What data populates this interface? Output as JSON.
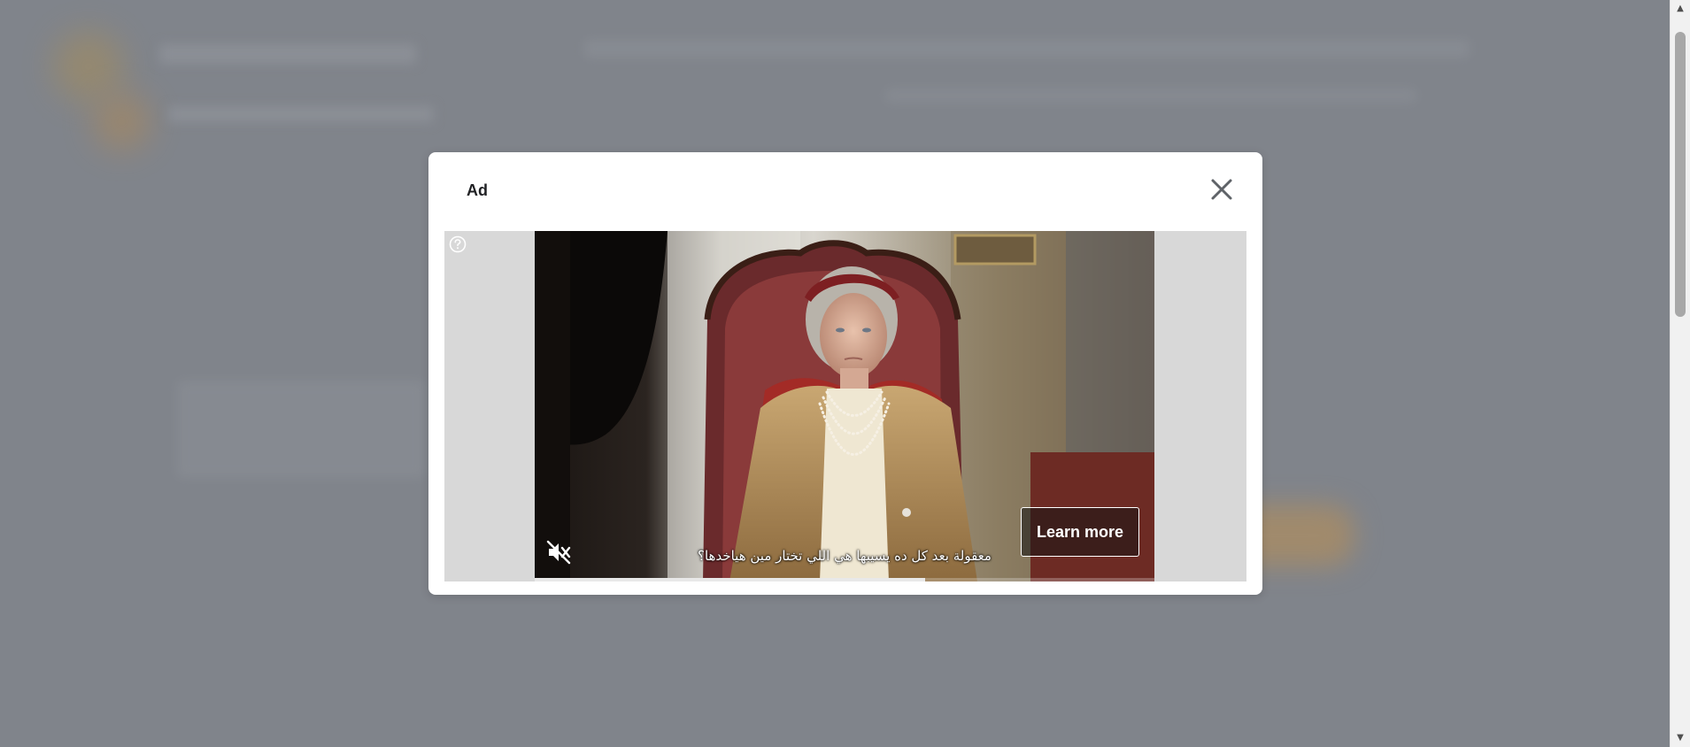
{
  "modal": {
    "title": "Ad",
    "close_icon": "close-icon"
  },
  "ad": {
    "help_icon": "question-circle-icon",
    "video": {
      "subtitle": "معقولة بعد كل ده يسيبها هي اللي تختار مين هياخدها؟",
      "mute_icon": "muted-speaker-icon",
      "muted": true,
      "progress": 0.63
    },
    "cta_label": "Learn more"
  },
  "colors": {
    "overlay": "#80848b",
    "modal_bg": "#ffffff",
    "ad_frame_bg": "#d8d8d8"
  }
}
